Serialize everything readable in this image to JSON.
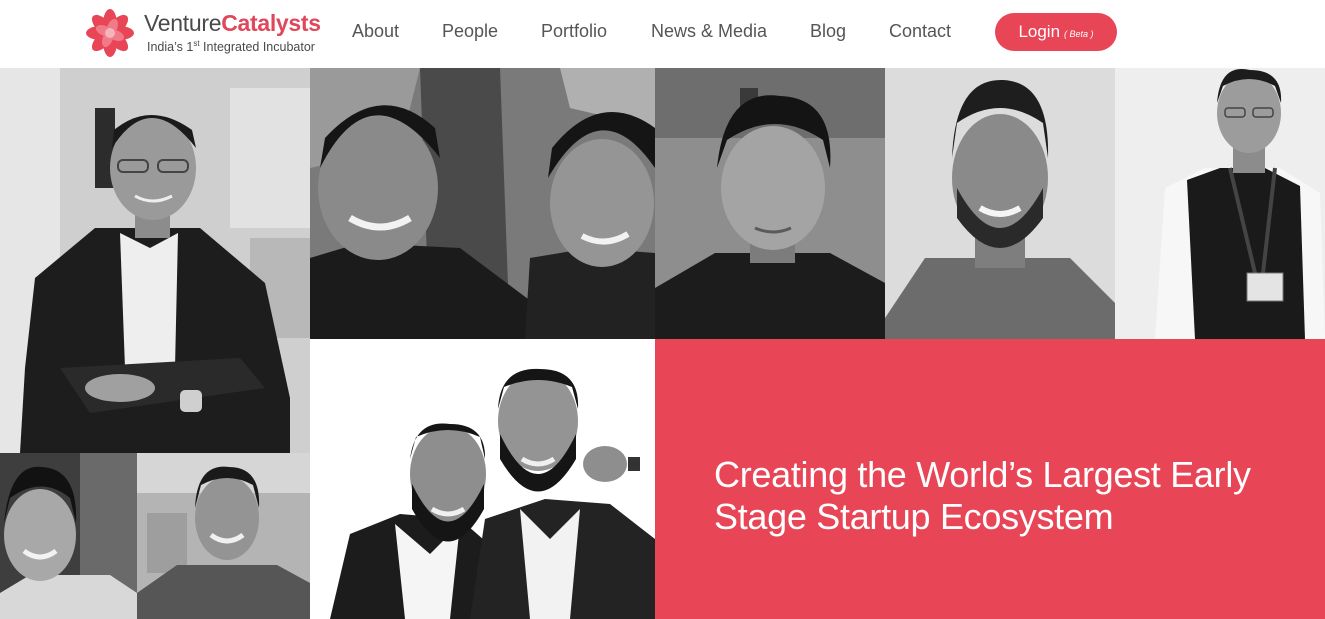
{
  "brand": {
    "name_part1": "Venture",
    "name_part2": "Catalysts",
    "tagline_pre": "India’s 1",
    "tagline_sup": "st",
    "tagline_post": " Integrated Incubator",
    "accent_color": "#e84557"
  },
  "nav": {
    "items": [
      {
        "label": "About"
      },
      {
        "label": "People"
      },
      {
        "label": "Portfolio"
      },
      {
        "label": "News & Media"
      },
      {
        "label": "Blog"
      },
      {
        "label": "Contact"
      }
    ],
    "login_label": "Login",
    "login_badge": "( Beta )"
  },
  "photos": [
    {
      "name": "person-suit-arms-crossed"
    },
    {
      "name": "two-men-smiling-tree"
    },
    {
      "name": "man-dark-tshirt"
    },
    {
      "name": "man-bearded-smiling"
    },
    {
      "name": "man-vest-id-badge"
    },
    {
      "name": "young-man-smiling"
    },
    {
      "name": "man-smiling-office"
    },
    {
      "name": "two-bearded-men-suits"
    }
  ],
  "hero": {
    "headline_line1": "Creating the World’s Largest Early",
    "headline_line2": "Stage Startup Ecosystem"
  }
}
